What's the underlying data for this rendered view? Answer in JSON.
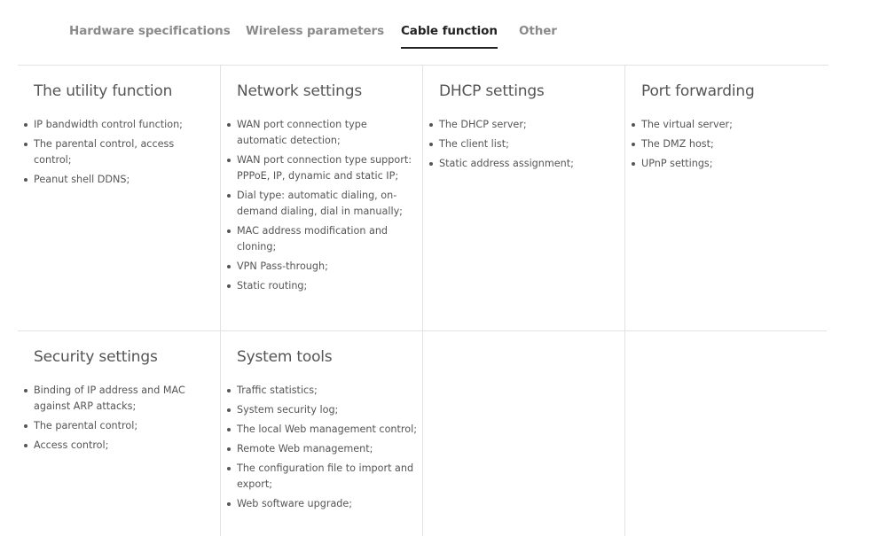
{
  "tabs": [
    {
      "label": "Hardware specifications",
      "active": false
    },
    {
      "label": "Wireless parameters",
      "active": false
    },
    {
      "label": "Cable function",
      "active": true
    },
    {
      "label": "Other",
      "active": false
    }
  ],
  "sections": [
    {
      "title": "The utility function",
      "items": [
        "IP bandwidth control function;",
        "The parental control, access control;",
        "Peanut shell DDNS;"
      ]
    },
    {
      "title": "Network settings",
      "items": [
        "WAN port connection type automatic detection;",
        "WAN port connection type support: PPPoE, IP, dynamic and static IP;",
        "Dial type: automatic dialing, on-demand dialing, dial in manually;",
        "MAC address modification and cloning;",
        "VPN Pass-through;",
        "Static routing;"
      ]
    },
    {
      "title": "DHCP settings",
      "items": [
        "The DHCP server;",
        "The client list;",
        "Static address assignment;"
      ]
    },
    {
      "title": "Port forwarding",
      "items": [
        "The virtual server;",
        "The DMZ host;",
        "UPnP settings;"
      ]
    },
    {
      "title": "Security settings",
      "items": [
        "Binding of IP address and MAC against ARP attacks;",
        "The parental control;",
        "Access control;"
      ]
    },
    {
      "title": "System tools",
      "items": [
        "Traffic statistics;",
        "System security log;",
        "The local Web management control;",
        "Remote Web management;",
        "The configuration file to import and export;",
        "Web software upgrade;"
      ]
    }
  ]
}
